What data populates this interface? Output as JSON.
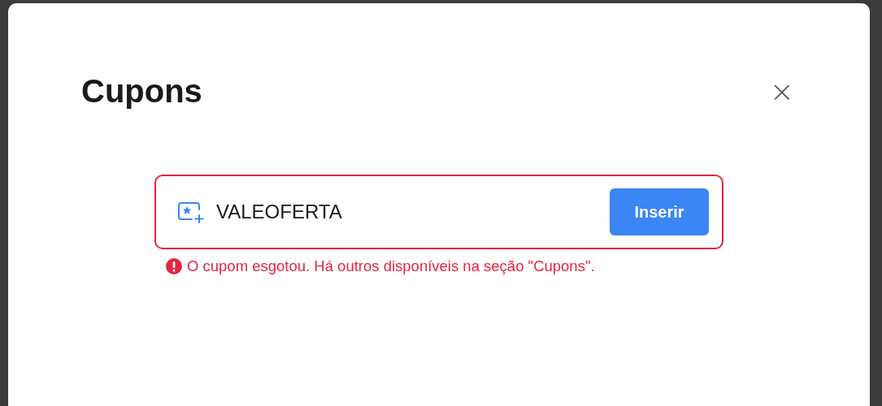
{
  "dialog": {
    "title": "Cupons",
    "close_label": "×",
    "coupon_field": {
      "value": "VALEOFERTA",
      "invalid": true
    },
    "submit_button": "Inserir",
    "error_message": "O cupom esgotou. Há outros disponíveis na seção \"Cupons\"."
  }
}
